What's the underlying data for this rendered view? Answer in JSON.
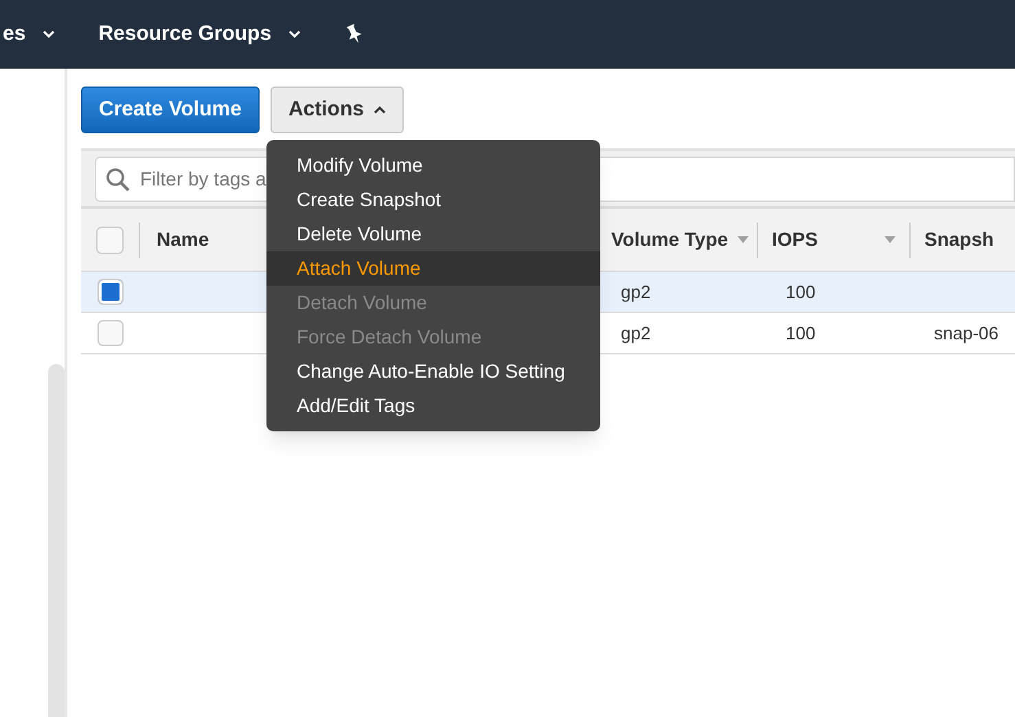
{
  "nav": {
    "items": [
      {
        "label": "es"
      },
      {
        "label": "Resource Groups"
      }
    ]
  },
  "toolbar": {
    "primary_button": "Create Volume",
    "actions_button": {
      "label": "Actions",
      "expanded": true
    }
  },
  "filter": {
    "placeholder": "Filter by tags a"
  },
  "table": {
    "all_selected": false,
    "columns": [
      "Name",
      "Volume Type",
      "IOPS",
      "Snapsh"
    ],
    "rows": [
      {
        "selected": true,
        "volume_type": "gp2",
        "iops": "100"
      },
      {
        "selected": false,
        "volume_type": "gp2",
        "iops": "100",
        "snapshot": "snap-06"
      }
    ]
  },
  "actions_menu": [
    {
      "label": "Modify Volume",
      "highlighted": false,
      "disabled": false
    },
    {
      "label": "Create Snapshot",
      "highlighted": false,
      "disabled": false
    },
    {
      "label": "Delete Volume",
      "highlighted": false,
      "disabled": false
    },
    {
      "label": "Attach Volume",
      "highlighted": true,
      "disabled": false
    },
    {
      "label": "Detach Volume",
      "highlighted": false,
      "disabled": true
    },
    {
      "label": "Force Detach Volume",
      "highlighted": false,
      "disabled": true
    },
    {
      "label": "Change Auto-Enable IO Setting",
      "highlighted": false,
      "disabled": false
    },
    {
      "label": "Add/Edit Tags",
      "highlighted": false,
      "disabled": false
    }
  ]
}
